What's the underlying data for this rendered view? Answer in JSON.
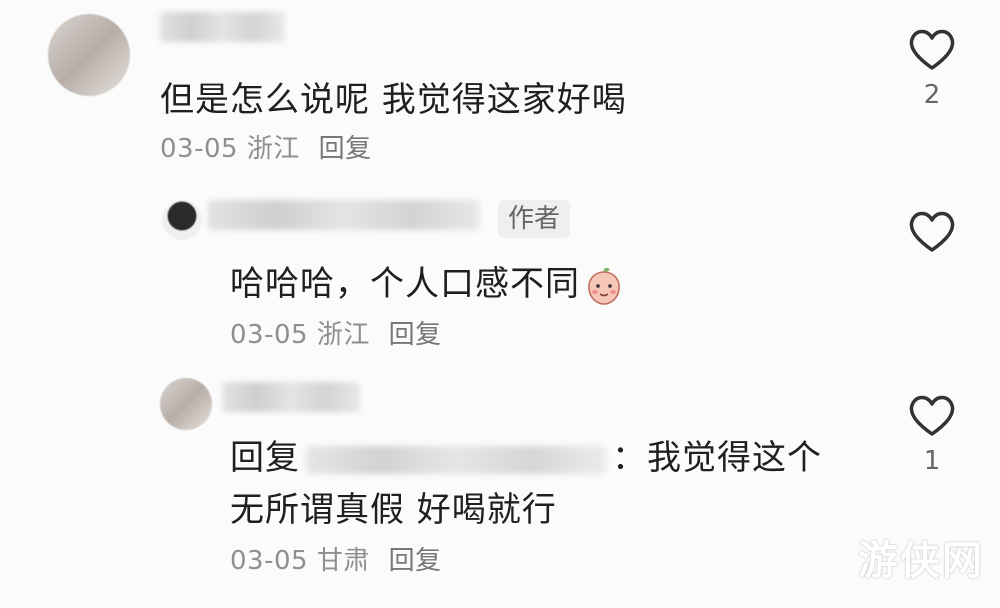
{
  "comments": [
    {
      "text": "但是怎么说呢 我觉得这家好喝",
      "date": "03-05",
      "location": "浙江",
      "reply_label": "回复",
      "like_count": "2"
    },
    {
      "author_tag": "作者",
      "text": "哈哈哈，个人口感不同",
      "date": "03-05",
      "location": "浙江",
      "reply_label": "回复",
      "like_count": ""
    },
    {
      "text_prefix": "回复",
      "text_colon": "：",
      "text_line1": "我觉得这个",
      "text_line2": "无所谓真假 好喝就行",
      "date": "03-05",
      "location": "甘肃",
      "reply_label": "回复",
      "like_count": "1"
    }
  ],
  "icons": {
    "like": "heart-outline-icon",
    "emoji": "peach-face-emoji"
  },
  "watermark": "游侠网"
}
